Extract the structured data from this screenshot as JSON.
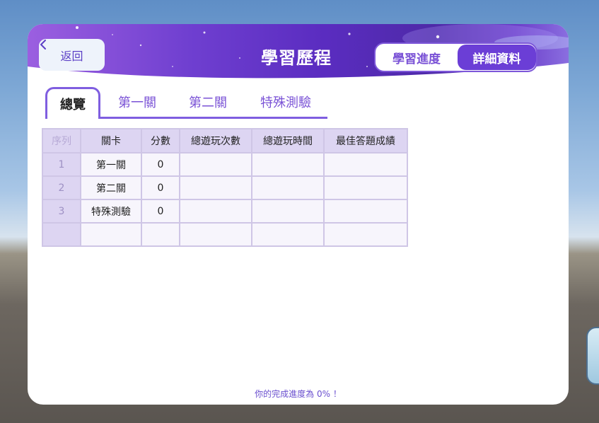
{
  "header": {
    "back_label": "返回",
    "title": "學習歷程",
    "toggle": {
      "progress_label": "學習進度",
      "detail_label": "詳細資料"
    }
  },
  "tabs": [
    "總覽",
    "第一關",
    "第二關",
    "特殊測驗"
  ],
  "table": {
    "headers": [
      "序列",
      "關卡",
      "分數",
      "總遊玩次數",
      "總遊玩時間",
      "最佳答題成績"
    ],
    "rows": [
      [
        "1",
        "第一關",
        "0",
        "",
        "",
        ""
      ],
      [
        "2",
        "第二關",
        "0",
        "",
        "",
        ""
      ],
      [
        "3",
        "特殊測驗",
        "0",
        "",
        "",
        ""
      ],
      [
        "",
        "",
        "",
        "",
        "",
        ""
      ]
    ]
  },
  "footer": {
    "progress_text": "你的完成進度為 0% ！"
  },
  "colors": {
    "accent": "#6b3ed6",
    "header_dark": "#4e2aa8",
    "table_header_bg": "#ddd5f2"
  },
  "icons": {
    "back": "chevron-left-icon",
    "side": "app-launcher-icon"
  }
}
